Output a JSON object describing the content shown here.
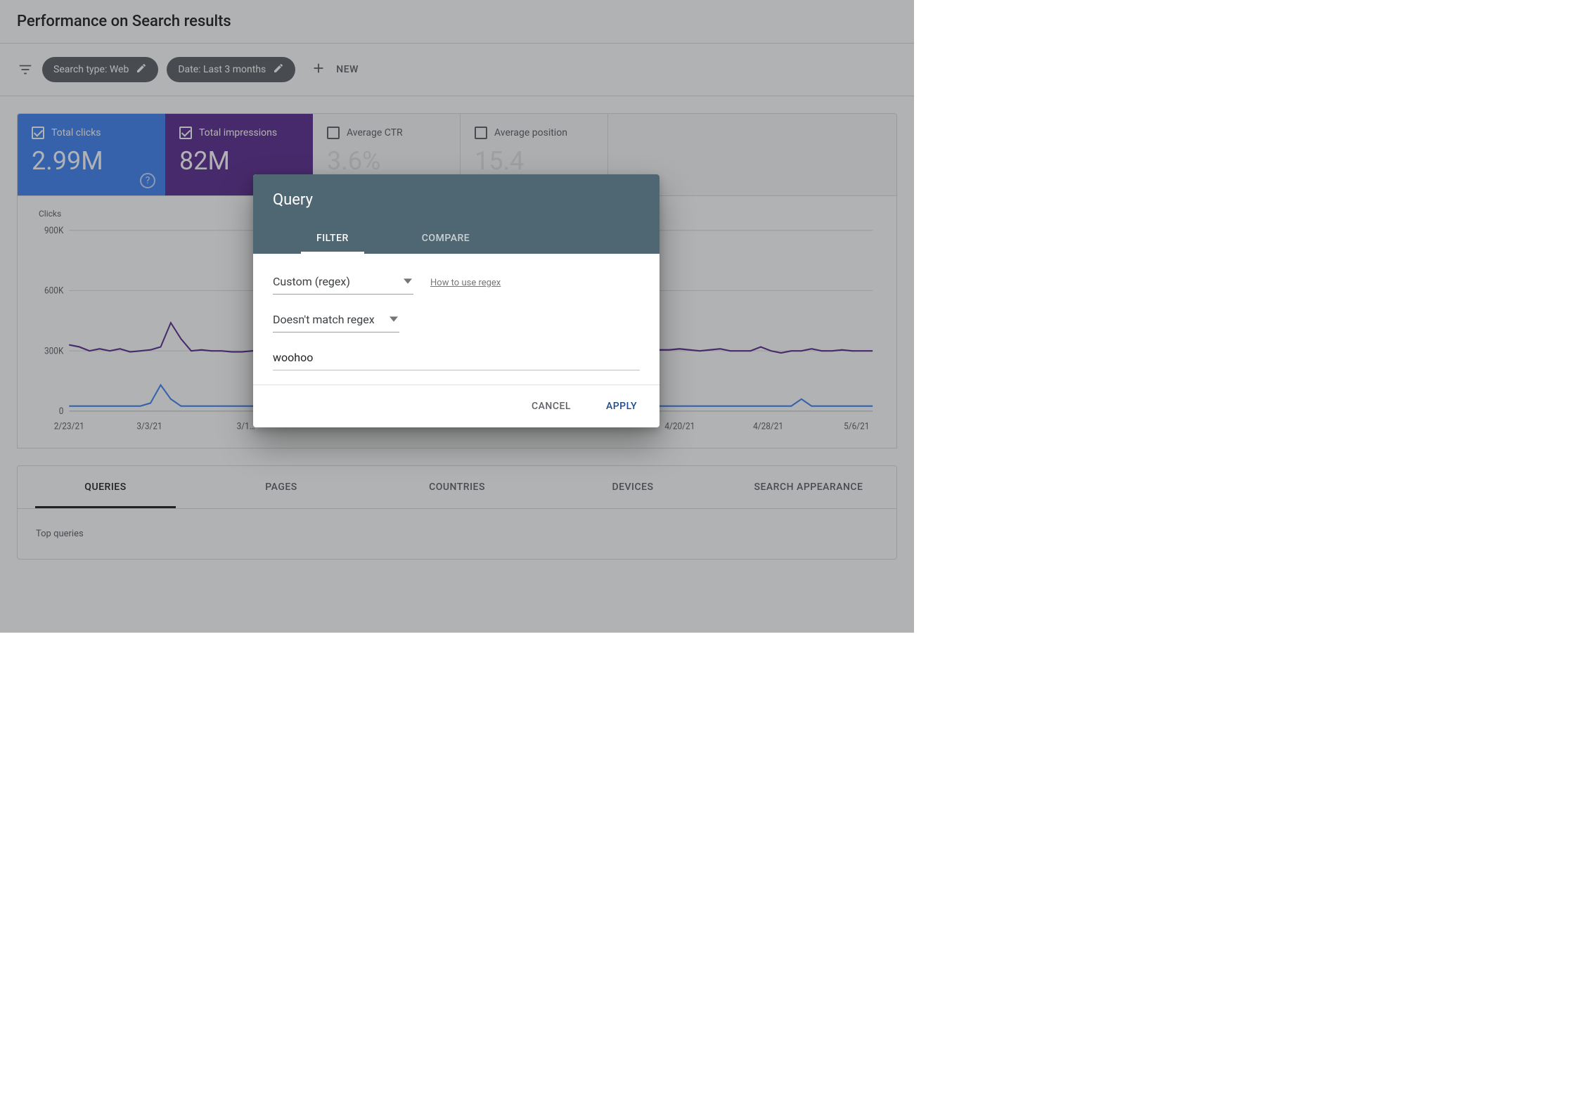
{
  "header": {
    "title": "Performance on Search results"
  },
  "filters": {
    "chip_search_type": "Search type: Web",
    "chip_date": "Date: Last 3 months",
    "new_label": "NEW"
  },
  "metrics": {
    "total_clicks": {
      "label": "Total clicks",
      "value": "2.99M"
    },
    "total_impressions": {
      "label": "Total impressions",
      "value": "82M"
    },
    "avg_ctr": {
      "label": "Average CTR",
      "value": "3.6%"
    },
    "avg_position": {
      "label": "Average position",
      "value": "15.4"
    }
  },
  "chart_axis_label": "Clicks",
  "tabs": {
    "queries": "QUERIES",
    "pages": "PAGES",
    "countries": "COUNTRIES",
    "devices": "DEVICES",
    "search_appearance": "SEARCH APPEARANCE"
  },
  "table": {
    "top_header": "Top queries"
  },
  "modal": {
    "title": "Query",
    "tabs": {
      "filter": "FILTER",
      "compare": "COMPARE"
    },
    "select_mode": "Custom (regex)",
    "help_link": "How to use regex",
    "select_match": "Doesn't match regex",
    "input_value": "woohoo",
    "cancel": "CANCEL",
    "apply": "APPLY"
  },
  "chart_data": {
    "type": "line",
    "xlabel": "",
    "ylabel": "Clicks",
    "ylim": [
      0,
      900000
    ],
    "y_ticks": [
      "900K",
      "600K",
      "300K",
      "0"
    ],
    "x_ticks": [
      "2/23/21",
      "3/3/21",
      "3/1…",
      "4/20/21",
      "4/28/21",
      "5/6/21"
    ],
    "series": [
      {
        "name": "Total impressions",
        "color": "#5c2e91",
        "values": [
          330000,
          320000,
          300000,
          310000,
          300000,
          310000,
          295000,
          300000,
          305000,
          320000,
          440000,
          360000,
          300000,
          305000,
          300000,
          300000,
          295000,
          295000,
          300000,
          300000,
          300000,
          305000,
          305000,
          300000,
          300000,
          300000,
          300000,
          300000,
          300000,
          300000,
          300000,
          300000,
          300000,
          305000,
          300000,
          295000,
          300000,
          300000,
          300000,
          300000,
          305000,
          300000,
          295000,
          300000,
          300000,
          300000,
          305000,
          300000,
          300000,
          300000,
          300000,
          300000,
          300000,
          300000,
          300000,
          305000,
          310000,
          310000,
          305000,
          305000,
          310000,
          305000,
          300000,
          305000,
          310000,
          300000,
          300000,
          300000,
          320000,
          300000,
          290000,
          300000,
          300000,
          310000,
          300000,
          300000,
          305000,
          300000,
          300000,
          300000
        ]
      },
      {
        "name": "Total clicks",
        "color": "#4285f4",
        "values": [
          25000,
          25000,
          25000,
          25000,
          25000,
          25000,
          25000,
          25000,
          40000,
          130000,
          60000,
          25000,
          25000,
          25000,
          25000,
          25000,
          25000,
          25000,
          25000,
          25000,
          25000,
          25000,
          25000,
          25000,
          25000,
          25000,
          25000,
          25000,
          25000,
          25000,
          25000,
          25000,
          25000,
          25000,
          25000,
          25000,
          25000,
          25000,
          25000,
          25000,
          25000,
          25000,
          25000,
          25000,
          25000,
          25000,
          25000,
          25000,
          25000,
          25000,
          25000,
          25000,
          25000,
          25000,
          25000,
          25000,
          25000,
          25000,
          25000,
          25000,
          25000,
          25000,
          25000,
          25000,
          25000,
          25000,
          25000,
          25000,
          25000,
          25000,
          25000,
          25000,
          60000,
          25000,
          25000,
          25000,
          25000,
          25000,
          25000,
          25000
        ]
      }
    ]
  }
}
